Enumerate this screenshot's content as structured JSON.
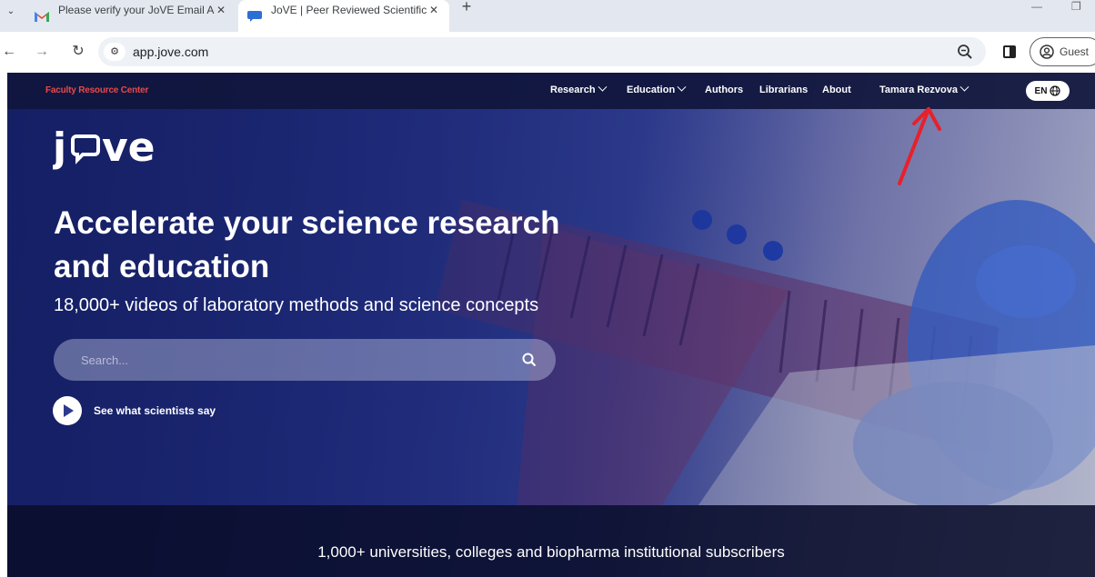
{
  "browser": {
    "tabs": [
      {
        "title": "Please verify your JoVE Email Ad",
        "active": false,
        "icon": "gmail-icon"
      },
      {
        "title": "JoVE | Peer Reviewed Scientific",
        "active": true,
        "icon": "jove-chat-icon"
      }
    ],
    "url": "app.jove.com",
    "profile_label": "Guest"
  },
  "site": {
    "faculty_link": "Faculty Resource Center",
    "nav": {
      "research": "Research",
      "education": "Education",
      "authors": "Authors",
      "librarians": "Librarians",
      "about": "About",
      "user": "Tamara Rezvova",
      "language": "EN"
    },
    "logo_text": "jove",
    "hero": {
      "title": "Accelerate your science research and education",
      "subtitle": "18,000+ videos of laboratory methods and science concepts",
      "search_placeholder": "Search...",
      "scientists_link": "See what scientists say"
    },
    "subscribers": "1,000+ universities, colleges and biopharma institutional subscribers"
  },
  "colors": {
    "faculty_link": "#e64a4a",
    "annotation_arrow": "#e8202a",
    "nav_bg": "#10163c",
    "hero_blue": "#263688"
  }
}
